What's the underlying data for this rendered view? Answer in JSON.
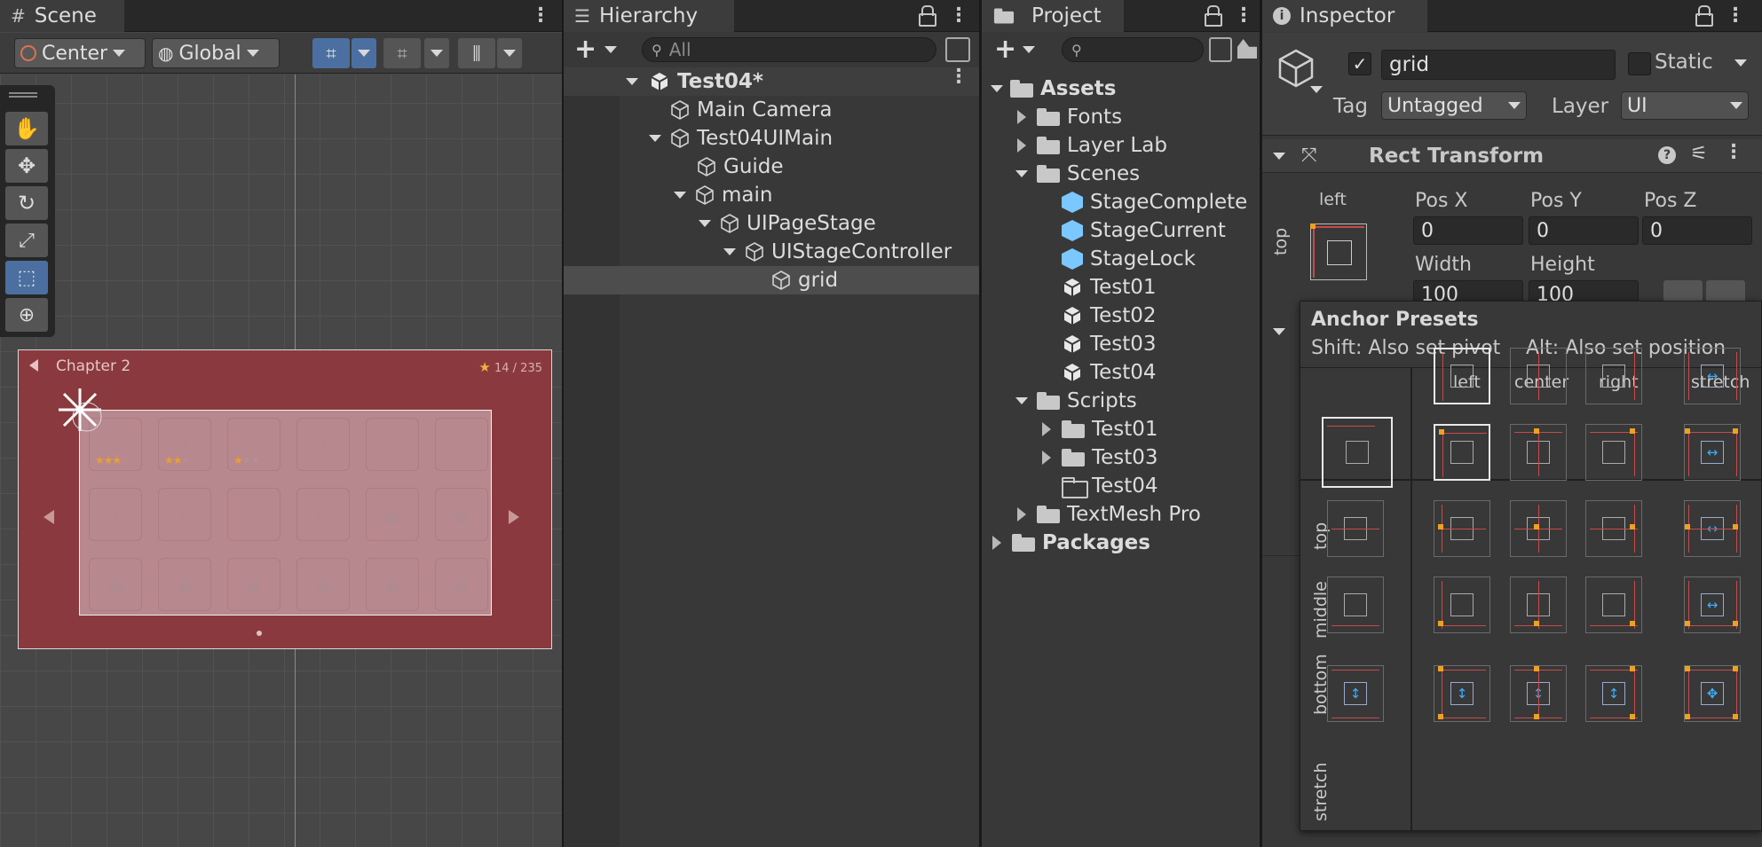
{
  "scene": {
    "tab": "Scene",
    "pivot": "Center",
    "space": "Global",
    "game": {
      "chapter": "Chapter 2",
      "stars": "14",
      "stars_total": "/ 235",
      "levels": [
        "1",
        "2",
        "3",
        "4",
        "5",
        "6",
        "7",
        "8",
        "9",
        "10",
        "",
        ""
      ],
      "level_stars": [
        "★★★",
        "★★★",
        "★★★",
        "",
        "",
        "",
        "",
        "",
        "",
        "",
        "",
        ""
      ]
    }
  },
  "hierarchy": {
    "tab": "Hierarchy",
    "search_placeholder": "All",
    "items": [
      "Test04*",
      "Main Camera",
      "Test04UIMain",
      "Guide",
      "main",
      "UIPageStage",
      "UIStageController",
      "grid"
    ]
  },
  "project": {
    "tab": "Project",
    "items": [
      "Assets",
      "Fonts",
      "Layer Lab",
      "Scenes",
      "StageComplete",
      "StageCurrent",
      "StageLock",
      "Test01",
      "Test02",
      "Test03",
      "Test04",
      "Scripts",
      "Test01",
      "Test03",
      "Test04",
      "TextMesh Pro",
      "Packages"
    ]
  },
  "inspector": {
    "tab": "Inspector",
    "object_name": "grid",
    "static_label": "Static",
    "tag_label": "Tag",
    "tag_value": "Untagged",
    "layer_label": "Layer",
    "layer_value": "UI",
    "component": "Rect Transform",
    "anchor_h": "left",
    "anchor_v": "top",
    "pos_x_label": "Pos X",
    "pos_y_label": "Pos Y",
    "pos_z_label": "Pos Z",
    "pos_x": "0",
    "pos_y": "0",
    "pos_z": "0",
    "width_label": "Width",
    "height_label": "Height",
    "width": "100",
    "height": "100",
    "presets": {
      "title": "Anchor Presets",
      "shift_hint": "Shift: Also set pivot",
      "alt_hint": "Alt: Also set position",
      "cols": [
        "left",
        "center",
        "right",
        "stretch"
      ],
      "rows": [
        "top",
        "middle",
        "bottom",
        "stretch"
      ]
    }
  },
  "colors": {
    "accent": "#4b6fa0",
    "selection": "#4d4d4d",
    "game_bg": "#8a3a3e"
  }
}
